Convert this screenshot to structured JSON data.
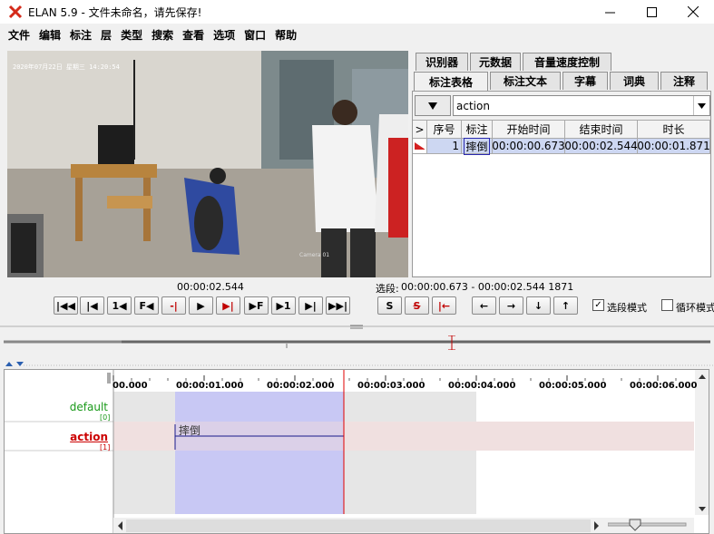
{
  "window": {
    "title": "ELAN 5.9 - 文件未命名，请先保存!"
  },
  "menu": [
    "文件",
    "编辑",
    "标注",
    "层",
    "类型",
    "搜索",
    "查看",
    "选项",
    "窗口",
    "帮助"
  ],
  "video": {
    "osd_timestamp": "2020年07月22日 星期三 14:20:54",
    "camera_label": "Camera 01"
  },
  "tabs_row1": [
    "识别器",
    "元数据",
    "音量速度控制"
  ],
  "tabs_row2": [
    "标注表格",
    "标注文本",
    "字幕",
    "词典",
    "注释"
  ],
  "tier_selector": {
    "value": "action"
  },
  "table": {
    "headers": [
      ">",
      "序号",
      "标注",
      "开始时间",
      "结束时间",
      "时长"
    ],
    "rows": [
      {
        "index": "1",
        "annotation": "摔倒",
        "start": "00:00:00.673",
        "end": "00:00:02.544",
        "duration": "00:00:01.871"
      }
    ]
  },
  "transport": {
    "current_time": "00:00:02.544",
    "selection_label": "选段:",
    "selection": "00:00:00.673 - 00:00:02.544  1871",
    "buttons": [
      "|◀◀",
      "|◀",
      "1◀",
      "F◀",
      "-|",
      "▶",
      "▶|",
      "▶F",
      "▶1",
      "▶|",
      "▶▶|"
    ],
    "sel_buttons": [
      "S",
      "S",
      "|←"
    ],
    "arrow_buttons": [
      "←",
      "→",
      "↓",
      "↑"
    ],
    "selection_mode_label": "选段模式",
    "selection_mode_checked": true,
    "loop_mode_label": "循环模式",
    "loop_mode_checked": false
  },
  "timeline": {
    "ruler": [
      "00.000",
      "00:00:01.000",
      "00:00:02.000",
      "00:00:03.000",
      "00:00:04.000",
      "00:00:05.000",
      "00:00:06.000"
    ],
    "tiers": [
      {
        "name": "default",
        "count": "[0]",
        "color": "#1a9a1a"
      },
      {
        "name": "action",
        "count": "[1]",
        "color": "#cc0000"
      }
    ],
    "annotation_label": "摔倒"
  },
  "colors": {
    "selection": "#c8c8f4",
    "crosshair": "#e00000",
    "row_highlight": "#cdd7f2"
  }
}
